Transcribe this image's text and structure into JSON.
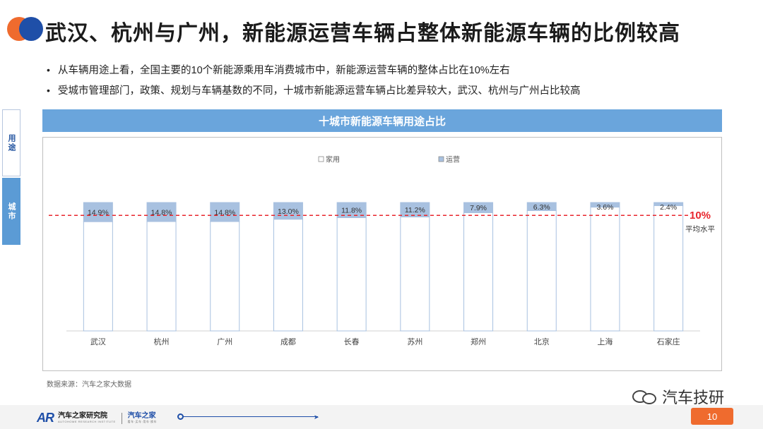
{
  "title": "武汉、杭州与广州，新能源运营车辆占整体新能源车辆的比例较高",
  "bullets": [
    "从车辆用途上看，全国主要的10个新能源乘用车消费城市中，新能源运营车辆的整体占比在10%左右",
    "受城市管理部门，政策、规划与车辆基数的不同，十城市新能源运营车辆占比差异较大，武汉、杭州与广州占比较高"
  ],
  "bullet_glyph": "•",
  "side_tabs": [
    {
      "label": "用途",
      "active": false
    },
    {
      "label": "城市",
      "active": true
    }
  ],
  "colors": {
    "accent_orange": "#ef6b2e",
    "accent_blue": "#1f4fa8",
    "header_blue": "#6aa5dc",
    "series_operating": "#a8c1e0",
    "series_family": "#ffffff",
    "reference_line": "#e8262d"
  },
  "source": "数据来源：汽车之家大数据",
  "brand": "汽车技研",
  "footer": {
    "logo_mark": "AR",
    "org1": "汽车之家研究院",
    "org1_sub": "AUTOHOME RESEARCH INSTITUTE",
    "org2": "汽车之家",
    "org2_sub": "看车·买车·用车·换车",
    "arrow": "➤",
    "page_number": "10"
  },
  "chart_data": {
    "type": "bar",
    "stacked": true,
    "title": "十城市新能源车辆用途占比",
    "categories": [
      "武汉",
      "杭州",
      "广州",
      "成都",
      "长春",
      "苏州",
      "郑州",
      "北京",
      "上海",
      "石家庄"
    ],
    "series": [
      {
        "name": "家用",
        "values": [
          85.1,
          85.2,
          85.2,
          87.0,
          88.2,
          88.8,
          92.1,
          93.7,
          96.4,
          97.6
        ]
      },
      {
        "name": "运营",
        "values": [
          14.9,
          14.8,
          14.8,
          13.0,
          11.8,
          11.2,
          7.9,
          6.3,
          3.6,
          2.4
        ]
      }
    ],
    "data_labels": [
      "14.9%",
      "14.8%",
      "14.8%",
      "13.0%",
      "11.8%",
      "11.2%",
      "7.9%",
      "6.3%",
      "3.6%",
      "2.4%"
    ],
    "legend_position": "top-center",
    "ylim": [
      0,
      100
    ],
    "reference_line": {
      "value": 10,
      "label": "10%",
      "sublabel": "平均水平"
    }
  }
}
